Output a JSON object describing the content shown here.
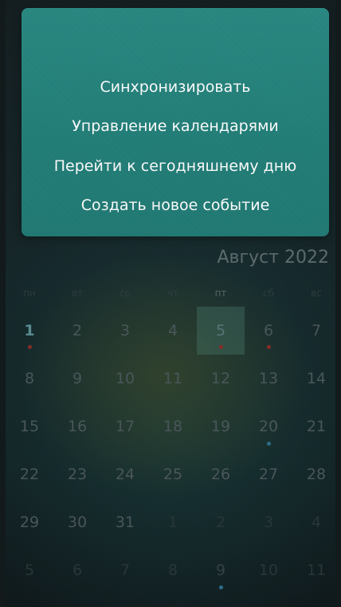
{
  "menu": {
    "items": [
      "Синхронизировать",
      "Управление календарями",
      "Перейти к сегодняшнему дню",
      "Создать новое событие"
    ]
  },
  "calendar": {
    "month_title": "Август 2022",
    "weekdays": [
      "пн",
      "вт",
      "ср",
      "чт",
      "пт",
      "сб",
      "вс"
    ],
    "weeks": [
      [
        "1",
        "2",
        "3",
        "4",
        "5",
        "6",
        "7"
      ],
      [
        "8",
        "9",
        "10",
        "11",
        "12",
        "13",
        "14"
      ],
      [
        "15",
        "16",
        "17",
        "18",
        "19",
        "20",
        "21"
      ],
      [
        "22",
        "23",
        "24",
        "25",
        "26",
        "27",
        "28"
      ],
      [
        "29",
        "30",
        "31",
        "1",
        "2",
        "3",
        "4"
      ],
      [
        "5",
        "6",
        "7",
        "8",
        "9",
        "10",
        "11"
      ]
    ],
    "selected_day": "5",
    "today": "1",
    "event_dots": [
      {
        "day": "1",
        "color": "#8a2d2b"
      },
      {
        "day": "5",
        "color": "#8a2d2b"
      },
      {
        "day": "6",
        "color": "#8a2d2b"
      },
      {
        "day": "20",
        "color": "#2f6f8a"
      },
      {
        "day": "9",
        "color": "#2f6f8a",
        "next_month": true
      }
    ]
  }
}
